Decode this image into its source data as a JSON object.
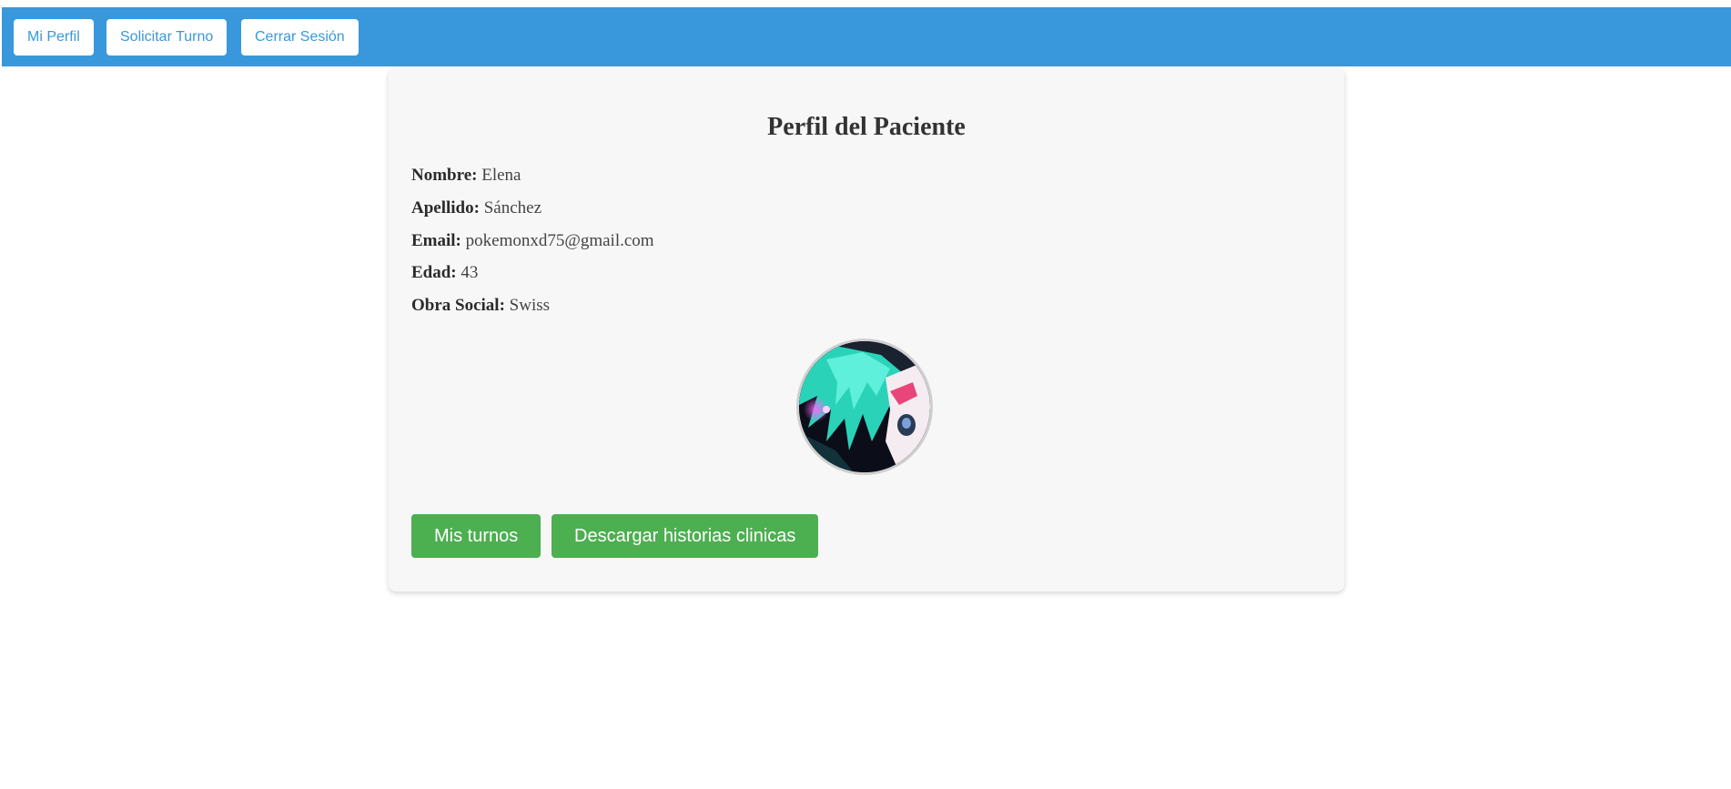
{
  "nav": {
    "items": [
      {
        "label": "Mi Perfil"
      },
      {
        "label": "Solicitar Turno"
      },
      {
        "label": "Cerrar Sesión"
      }
    ]
  },
  "profile": {
    "title": "Perfil del Paciente",
    "fields": [
      {
        "label": "Nombre:",
        "value": "Elena"
      },
      {
        "label": "Apellido:",
        "value": "Sánchez"
      },
      {
        "label": "Email:",
        "value": "pokemonxd75@gmail.com"
      },
      {
        "label": "Edad:",
        "value": "43"
      },
      {
        "label": "Obra Social:",
        "value": "Swiss"
      }
    ],
    "avatar_icon": "profile-photo-anime-character"
  },
  "actions": {
    "turnos_label": "Mis turnos",
    "descargar_label": "Descargar historias clinicas"
  },
  "colors": {
    "navbar": "#3898db",
    "action": "#4caf50",
    "card": "#f7f7f7"
  }
}
